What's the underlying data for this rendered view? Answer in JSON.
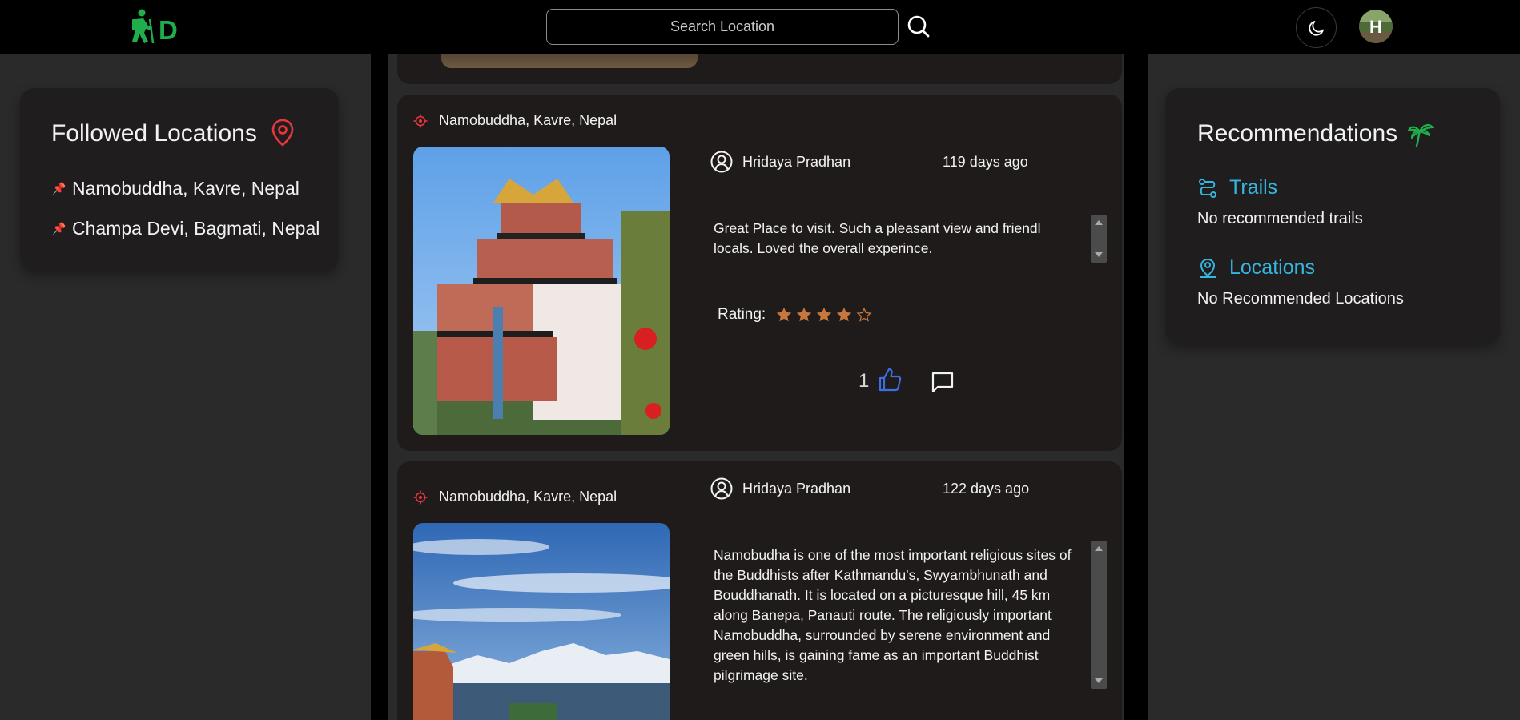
{
  "header": {
    "search_placeholder": "Search Location",
    "logo_text": "D",
    "avatar_letter": "H"
  },
  "followed": {
    "title": "Followed Locations",
    "items": [
      {
        "label": "Namobuddha, Kavre, Nepal"
      },
      {
        "label": "Champa Devi, Bagmati, Nepal"
      }
    ]
  },
  "posts": [
    {
      "location": "Namobuddha, Kavre, Nepal",
      "user": "Hridaya Pradhan",
      "time_ago": "119 days ago",
      "description": "Great Place to visit. Such a pleasant view and friendl locals. Loved the overall experince.",
      "rating_label": "Rating:",
      "rating": 4,
      "rating_max": 5,
      "likes": "1"
    },
    {
      "location": "Namobuddha, Kavre, Nepal",
      "user": "Hridaya Pradhan",
      "time_ago": "122 days ago",
      "description": "Namobudha is one of the most important religious sites of the Buddhists after Kathmandu's, Swyambhunath and Bouddhanath. It is located on a picturesque hill, 45 km along Banepa, Panauti route. The religiously important Namobuddha, surrounded by serene environment and green hills, is gaining fame as an important Buddhist pilgrimage site."
    }
  ],
  "recommendations": {
    "title": "Recommendations",
    "trails_label": "Trails",
    "trails_empty": "No recommended trails",
    "locations_label": "Locations",
    "locations_empty": "No Recommended Locations"
  },
  "colors": {
    "accent_green": "#1fae4b",
    "accent_blue": "#35b6e0",
    "pin_red": "#e8363c",
    "star_orange": "#c7773b",
    "like_blue": "#3b6fe0"
  },
  "icons": [
    "hiker-logo-icon",
    "search-icon",
    "moon-icon",
    "map-pin-icon",
    "pushpin-icon",
    "target-icon",
    "user-circle-icon",
    "star-icon",
    "thumbs-up-icon",
    "comment-icon",
    "palm-tree-icon",
    "route-icon",
    "location-user-icon"
  ]
}
